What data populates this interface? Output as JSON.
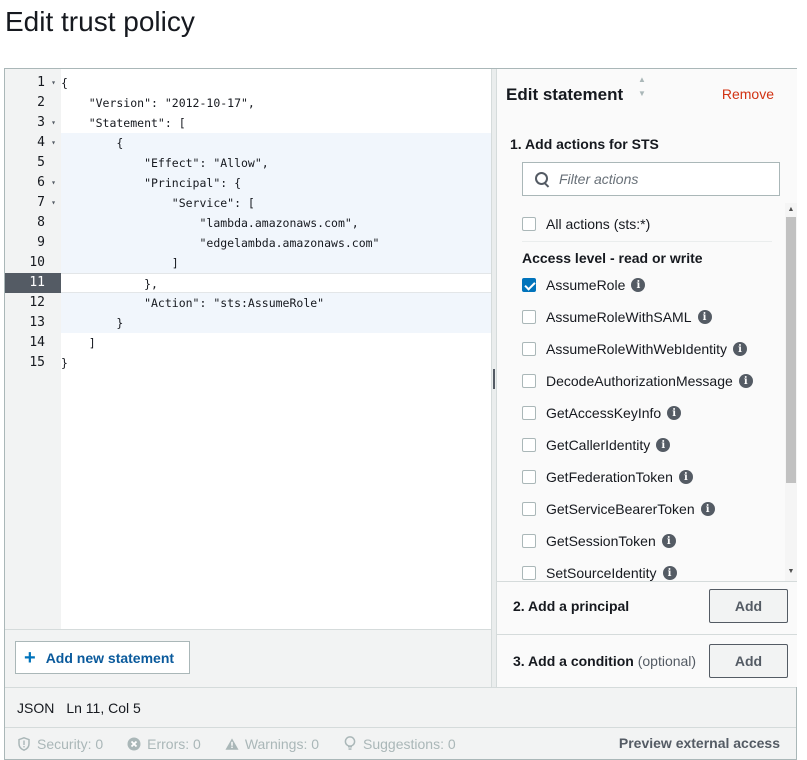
{
  "page": {
    "title": "Edit trust policy"
  },
  "editor": {
    "gutter": [
      {
        "num": "1",
        "fold": "▾"
      },
      {
        "num": "2",
        "fold": ""
      },
      {
        "num": "3",
        "fold": "▾"
      },
      {
        "num": "4",
        "fold": "▾"
      },
      {
        "num": "5",
        "fold": ""
      },
      {
        "num": "6",
        "fold": "▾"
      },
      {
        "num": "7",
        "fold": "▾"
      },
      {
        "num": "8",
        "fold": ""
      },
      {
        "num": "9",
        "fold": ""
      },
      {
        "num": "10",
        "fold": ""
      },
      {
        "num": "11",
        "fold": ""
      },
      {
        "num": "12",
        "fold": ""
      },
      {
        "num": "13",
        "fold": ""
      },
      {
        "num": "14",
        "fold": ""
      },
      {
        "num": "15",
        "fold": ""
      }
    ],
    "active_line": 11,
    "lines": [
      "{",
      "    \"Version\": \"2012-10-17\",",
      "    \"Statement\": [",
      "        {",
      "            \"Effect\": \"Allow\",",
      "            \"Principal\": {",
      "                \"Service\": [",
      "                    \"lambda.amazonaws.com\",",
      "                    \"edgelambda.amazonaws.com\"",
      "                ]",
      "            },",
      "            \"Action\": \"sts:AssumeRole\"",
      "        }",
      "    ]",
      "}"
    ],
    "add_statement_label": "Add new statement"
  },
  "side_panel": {
    "title": "Edit statement",
    "remove_label": "Remove",
    "actions_heading": "1. Add actions for STS",
    "filter_placeholder": "Filter actions",
    "all_actions_label": "All actions (sts:*)",
    "access_level_heading": "Access level - read or write",
    "actions": [
      {
        "label": "AssumeRole",
        "checked": true
      },
      {
        "label": "AssumeRoleWithSAML",
        "checked": false
      },
      {
        "label": "AssumeRoleWithWebIdentity",
        "checked": false
      },
      {
        "label": "DecodeAuthorizationMessage",
        "checked": false
      },
      {
        "label": "GetAccessKeyInfo",
        "checked": false
      },
      {
        "label": "GetCallerIdentity",
        "checked": false
      },
      {
        "label": "GetFederationToken",
        "checked": false
      },
      {
        "label": "GetServiceBearerToken",
        "checked": false
      },
      {
        "label": "GetSessionToken",
        "checked": false
      },
      {
        "label": "SetSourceIdentity",
        "checked": false
      }
    ],
    "principal_heading": "2. Add a principal",
    "condition_heading": "3. Add a condition",
    "condition_optional": "(optional)",
    "add_label": "Add"
  },
  "status": {
    "mode": "JSON",
    "position": "Ln 11, Col 5"
  },
  "validation": {
    "security": "Security: 0",
    "errors": "Errors: 0",
    "warnings": "Warnings: 0",
    "suggestions": "Suggestions: 0",
    "preview_label": "Preview external access"
  },
  "colors": {
    "accent": "#0073bb",
    "remove": "#d13212",
    "highlight": "#f1f6fc"
  }
}
